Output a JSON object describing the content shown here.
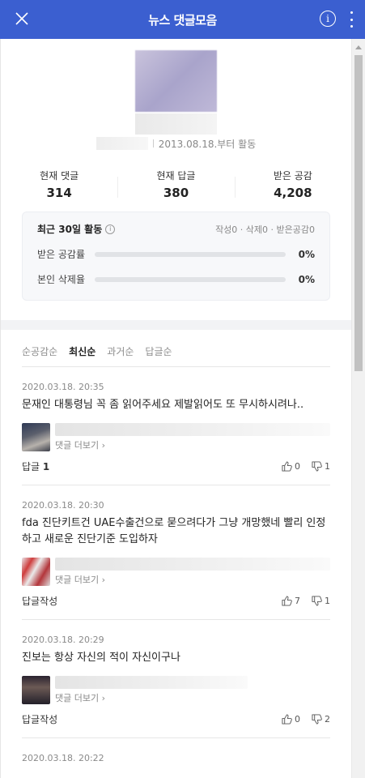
{
  "header": {
    "title": "뉴스 댓글모음",
    "info_glyph": "i"
  },
  "profile": {
    "since": "2013.08.18.부터 활동"
  },
  "stats": [
    {
      "label": "현재 댓글",
      "value": "314"
    },
    {
      "label": "현재 답글",
      "value": "380"
    },
    {
      "label": "받은 공감",
      "value": "4,208"
    }
  ],
  "activity": {
    "title": "최근 30일 활동",
    "info_glyph": "i",
    "counts": "작성0 · 삭제0 · 받은공감0",
    "rows": [
      {
        "label": "받은 공감률",
        "pct": "0%",
        "fraction": 0
      },
      {
        "label": "본인 삭제율",
        "pct": "0%",
        "fraction": 0
      }
    ]
  },
  "tabs": [
    {
      "label": "순공감순",
      "active": false
    },
    {
      "label": "최신순",
      "active": true
    },
    {
      "label": "과거순",
      "active": false
    },
    {
      "label": "답글순",
      "active": false
    }
  ],
  "comments": [
    {
      "date": "2020.03.18. 20:35",
      "text": "문재인 대통령님 꼭 좀 읽어주세요 제발읽어도 또 무시하시려나..",
      "more_link": "댓글 더보기 ›",
      "reply_label": "답글",
      "reply_count": "1",
      "likes": "0",
      "dislikes": "1"
    },
    {
      "date": "2020.03.18. 20:30",
      "text": "fda 진단키트건 UAE수출건으로 묻으려다가 그냥 개망했네 빨리 인정하고 새로운 진단기준 도입하자",
      "more_link": "댓글 더보기 ›",
      "reply_label": "답글작성",
      "reply_count": "",
      "likes": "7",
      "dislikes": "1"
    },
    {
      "date": "2020.03.18. 20:29",
      "text": "진보는 항상 자신의 적이 자신이구나",
      "more_link": "댓글 더보기 ›",
      "reply_label": "답글작성",
      "reply_count": "",
      "likes": "0",
      "dislikes": "2"
    },
    {
      "date": "2020.03.18. 20:22"
    }
  ]
}
